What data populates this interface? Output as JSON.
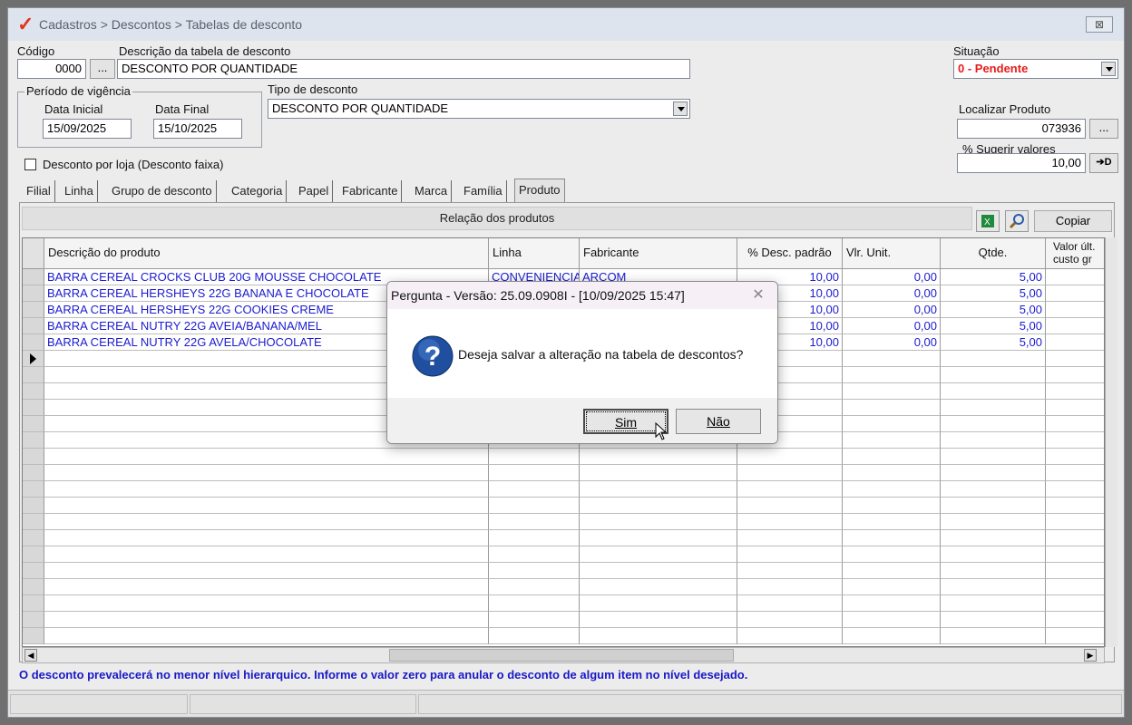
{
  "window": {
    "title": "Cadastros > Descontos > Tabelas de desconto",
    "close_label": "⊠"
  },
  "form": {
    "codigo_label": "Código",
    "codigo_value": "0000",
    "ellipsis": "...",
    "descricao_label": "Descrição da tabela de desconto",
    "descricao_value": "DESCONTO POR QUANTIDADE",
    "situacao_label": "Situação",
    "situacao_value": "0 - Pendente",
    "periodo_label": "Período de vigência",
    "data_inicial_label": "Data Inicial",
    "data_inicial_value": "15/09/2025",
    "data_final_label": "Data Final",
    "data_final_value": "15/10/2025",
    "tipo_label": "Tipo de desconto",
    "tipo_value": "DESCONTO POR QUANTIDADE",
    "localizar_label": "Localizar Produto",
    "localizar_value": "073936",
    "sugerir_label": "% Sugerir valores",
    "sugerir_value": "10,00",
    "desconto_loja_label": "Desconto por loja (Desconto faixa)",
    "apply_btn": "➔D"
  },
  "tabs": [
    "Filial",
    "Linha",
    "Grupo de desconto",
    "Categoria",
    "Papel",
    "Fabricante",
    "Marca",
    "Família",
    "Produto"
  ],
  "panel": {
    "header": "Relação dos produtos",
    "copiar": "Copiar"
  },
  "grid": {
    "columns": [
      "Descrição do produto",
      "Linha",
      "Fabricante",
      "% Desc. padrão",
      "Vlr. Unit.",
      "Qtde.",
      "Valor últ. custo gr"
    ],
    "rows": [
      {
        "descricao": "BARRA CEREAL CROCKS CLUB 20G MOUSSE CHOCOLATE",
        "linha": "CONVENIENCIA",
        "fabricante": "ARCOM",
        "desc": "10,00",
        "vlr": "0,00",
        "qtde": "5,00"
      },
      {
        "descricao": "BARRA CEREAL HERSHEYS 22G BANANA E CHOCOLATE",
        "linha": "",
        "fabricante": "",
        "desc": "10,00",
        "vlr": "0,00",
        "qtde": "5,00"
      },
      {
        "descricao": "BARRA CEREAL HERSHEYS 22G COOKIES CREME",
        "linha": "",
        "fabricante": "",
        "desc": "10,00",
        "vlr": "0,00",
        "qtde": "5,00"
      },
      {
        "descricao": "BARRA CEREAL NUTRY 22G AVEIA/BANANA/MEL",
        "linha": "",
        "fabricante": "",
        "desc": "10,00",
        "vlr": "0,00",
        "qtde": "5,00"
      },
      {
        "descricao": "BARRA CEREAL NUTRY 22G AVELA/CHOCOLATE",
        "linha": "",
        "fabricante": "",
        "desc": "10,00",
        "vlr": "0,00",
        "qtde": "5,00"
      }
    ]
  },
  "footer_note": "O desconto prevalecerá no menor nível hierarquico. Informe o valor zero para anular o desconto de algum item no nível desejado.",
  "dialog": {
    "title": "Pergunta - Versão: 25.09.0908I - [10/09/2025 15:47]",
    "message": "Deseja salvar a alteração na tabela de descontos?",
    "yes": "Sim",
    "no": "Não"
  },
  "colors": {
    "situacao_text": "#e81b1b",
    "grid_text": "#1c1ccf",
    "footer_text": "#1818c8"
  }
}
